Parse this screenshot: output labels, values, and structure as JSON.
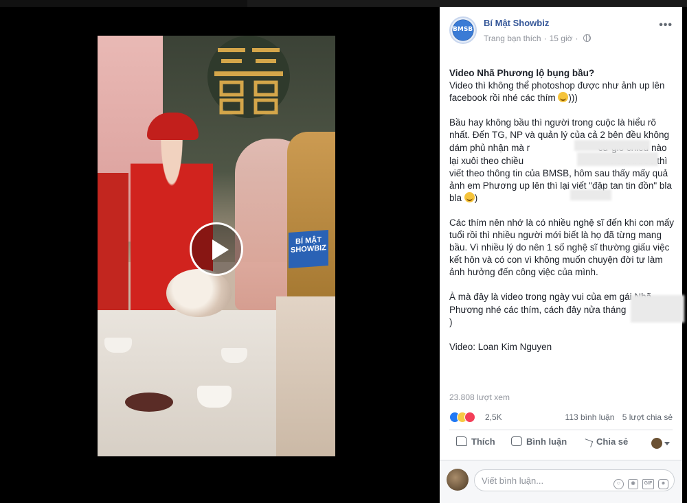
{
  "post": {
    "page_name": "Bí Mật Showbiz",
    "avatar_text": "BMSB",
    "meta_prefix": "Trang bạn thích",
    "time": "15 giờ",
    "more": "•••",
    "title": "Video Nhã Phương lộ bụng bầu?",
    "p1": "Video thì không thể photoshop được như ảnh up lên facebook rồi nhé các thím",
    "p1_end": ")))",
    "p2_a": "Bầu hay không bầu thì người trong cuộc là hiểu rõ nhất. Đến TG, NP và quản lý của cả 2 bên đều không dám phủ nhận mà r",
    "p2_b": "cứ gió chiều nào lại xuôi theo chiều",
    "p2_c": "hôm trước thì viết theo thông tin của BMSB, hôm sau thấy mấy quả ảnh em Phương up lên thì lại viết \"đập tan tin đồn\" bla bla",
    "p2_end": ")",
    "p3": "Các thím nên nhớ là có nhiều nghệ sĩ đến khi con mấy tuổi rồi thì nhiều người mới biết là họ đã từng mang bầu. Vì nhiều lý do nên 1 số nghệ sĩ thường giấu việc kết hôn và có con vì không muốn chuyện đời tư làm ảnh hưởng đến công việc của mình.",
    "p4_a": "À mà đây là video trong ngày vui của em gái Nhã Phương nhé các thím, cách đây nửa tháng",
    "p4_end": ")",
    "credit": "Video: Loan Kim Nguyen",
    "views": "23.808 lượt xem",
    "reaction_count": "2,5K",
    "comments": "113 bình luận",
    "shares": "5 lượt chia sẻ"
  },
  "actions": {
    "like": "Thích",
    "comment": "Bình luận",
    "share": "Chia sẻ"
  },
  "comment_input": {
    "placeholder": "Viết bình luận..."
  },
  "video": {
    "watermark_line1": "BÍ MẬT",
    "watermark_line2": "SHOWBIZ"
  },
  "colors": {
    "link": "#365899",
    "like": "#2078f4",
    "love": "#f33e58",
    "haha": "#f7c944"
  }
}
